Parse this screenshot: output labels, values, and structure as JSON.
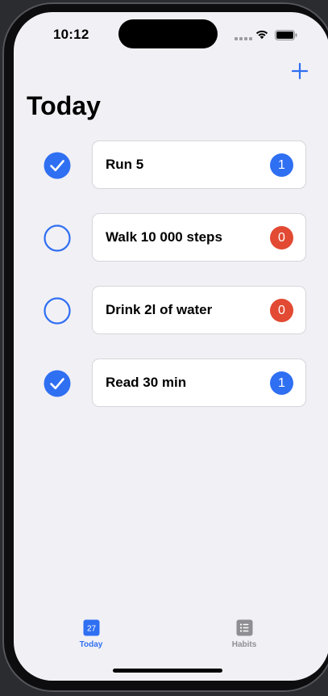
{
  "status_bar": {
    "time": "10:12"
  },
  "header": {
    "add_icon": "plus-icon",
    "title": "Today"
  },
  "habits": [
    {
      "name": "Run 5",
      "done": true,
      "count": "1",
      "count_color": "#2f6ff2"
    },
    {
      "name": "Walk 10 000 steps",
      "done": false,
      "count": "0",
      "count_color": "#e24a33"
    },
    {
      "name": "Drink 2l of water",
      "done": false,
      "count": "0",
      "count_color": "#e24a33"
    },
    {
      "name": "Read 30 min",
      "done": true,
      "count": "1",
      "count_color": "#2f6ff2"
    }
  ],
  "tabbar": {
    "today": {
      "label": "Today",
      "icon": "calendar-icon",
      "day": "27",
      "active": true
    },
    "habits": {
      "label": "Habits",
      "icon": "list-icon",
      "active": false
    }
  },
  "colors": {
    "accent": "#2f6ff2",
    "danger": "#e24a33",
    "inactive": "#8e8e93",
    "background": "#f1f0f5"
  }
}
